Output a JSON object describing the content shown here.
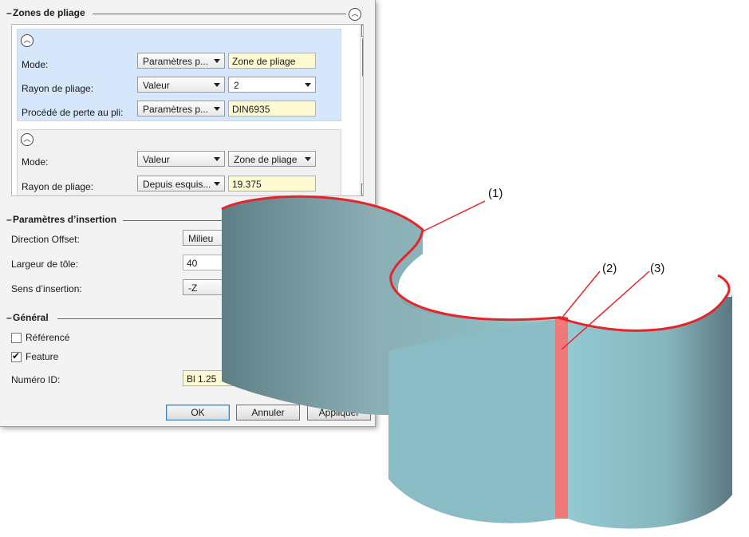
{
  "zones": {
    "title": "Zones de pliage",
    "zone1": {
      "mode_label": "Mode:",
      "mode_value": "Paramètres p...",
      "mode_field": "Zone de pliage",
      "radius_label": "Rayon de pliage:",
      "radius_value": "Valeur",
      "radius_field": "2",
      "process_label": "Procédé de perte au pli:",
      "process_value": "Paramètres p...",
      "process_field": "DIN6935"
    },
    "zone2": {
      "mode_label": "Mode:",
      "mode_value": "Valeur",
      "mode_field": "Zone de pliage",
      "radius_label": "Rayon de pliage:",
      "radius_value": "Depuis esquis...",
      "radius_field": "19.375"
    }
  },
  "insertion": {
    "title": "Paramètres d’insertion",
    "direction_label": "Direction Offset:",
    "direction_value": "Milieu",
    "width_label": "Largeur de tôle:",
    "width_value": "40",
    "sense_label": "Sens d’insertion:",
    "sense_value": "-Z"
  },
  "general": {
    "title": "Général",
    "referenced_label": "Référencé",
    "referenced_checked": false,
    "feature_label": "Feature",
    "feature_checked": true,
    "id_label": "Numéro ID:",
    "id_value": "Bl 1.25"
  },
  "buttons": {
    "ok": "OK",
    "cancel": "Annuler",
    "apply": "Appliquer"
  },
  "callouts": [
    "(1)",
    "(2)",
    "(3)"
  ],
  "colors": {
    "part_body": "#8fc4cc",
    "part_shadow": "#6f8f95",
    "edge_highlight": "#e3262c",
    "bend_zone": "#f07a78",
    "zone_selected_bg": "#d6e7fb",
    "field_yellow": "#fefbd3"
  }
}
